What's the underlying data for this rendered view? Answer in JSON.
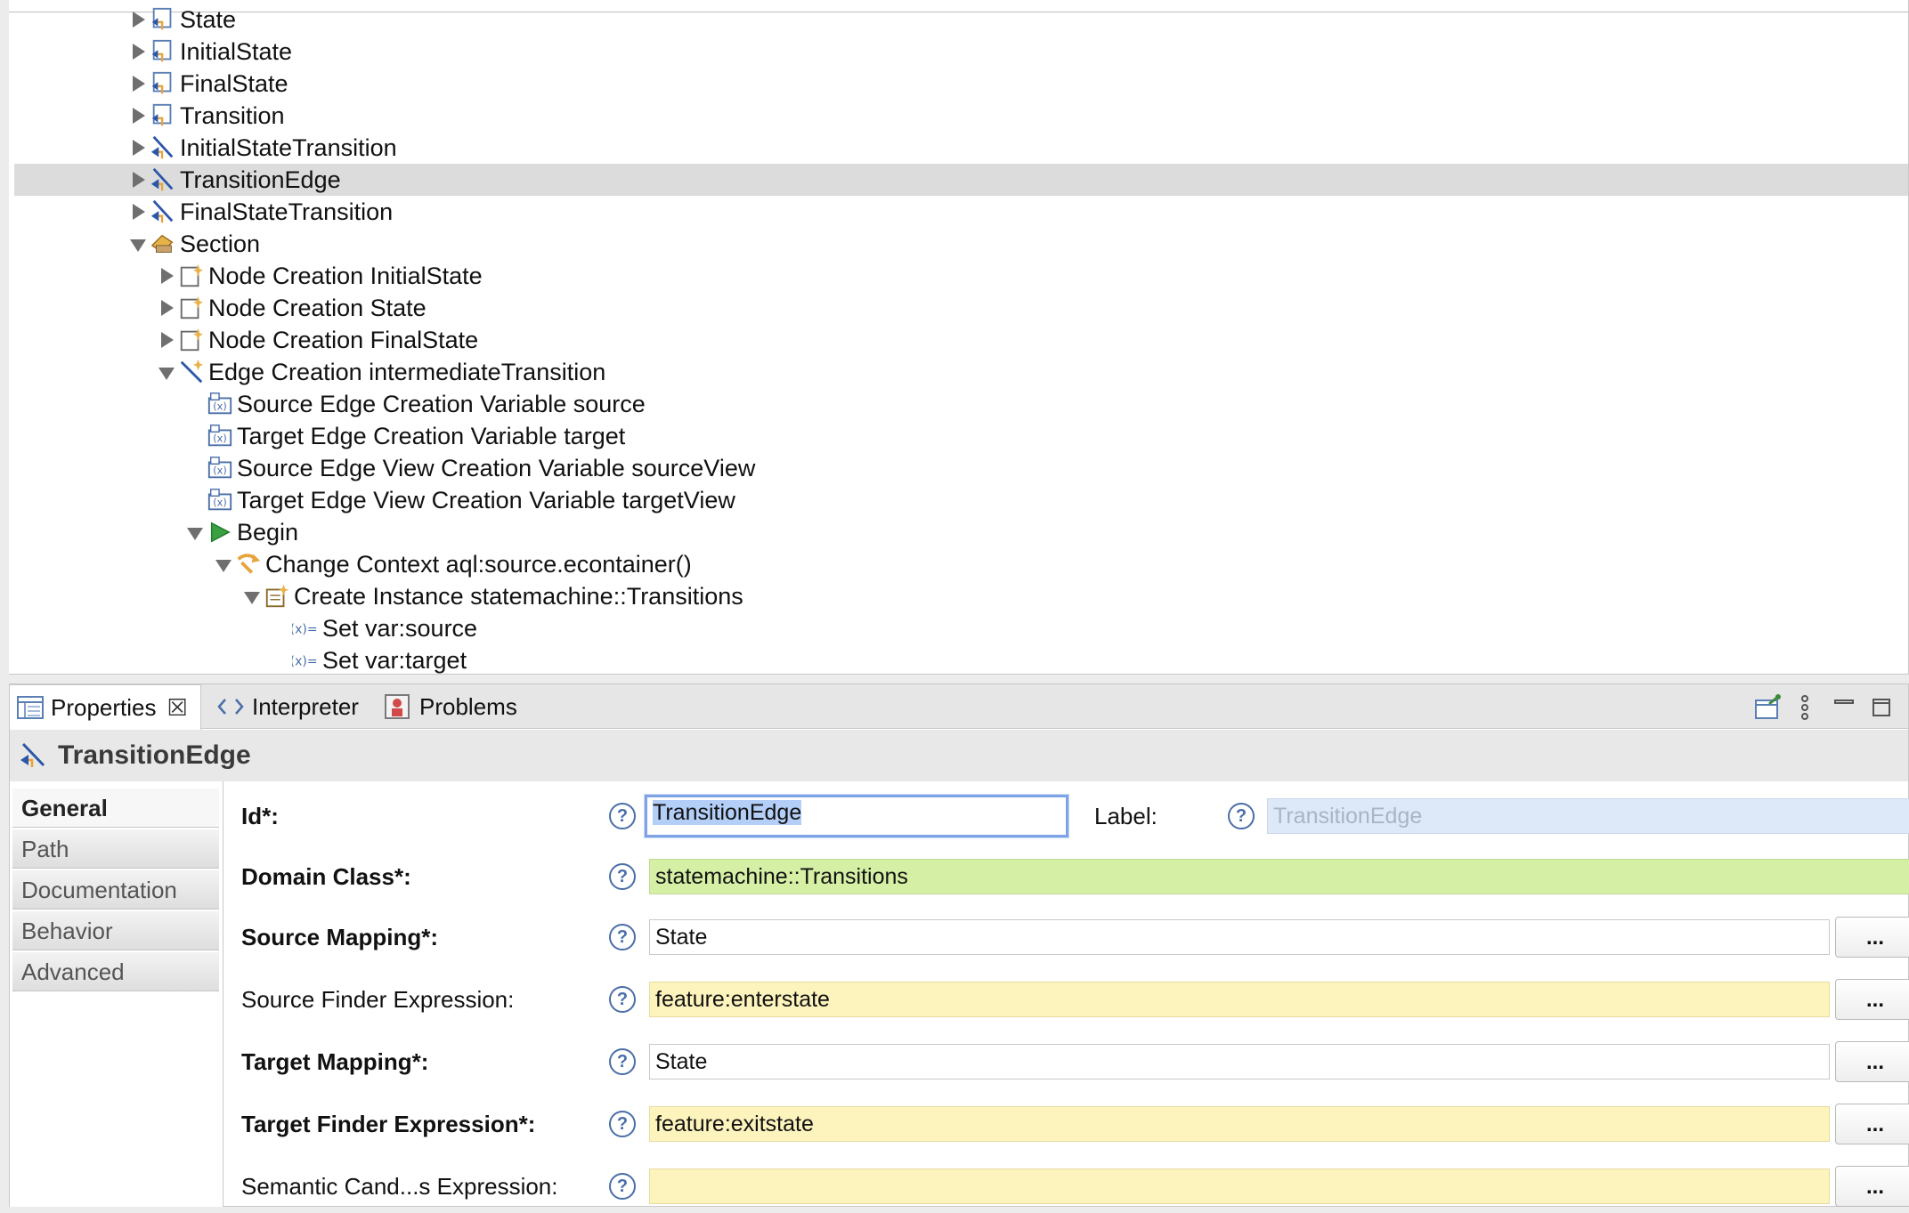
{
  "tree": [
    {
      "label": "State",
      "depth": 0,
      "state": "collapsed",
      "icon": "node-mapping-icon"
    },
    {
      "label": "InitialState",
      "depth": 0,
      "state": "collapsed",
      "icon": "node-mapping-icon"
    },
    {
      "label": "FinalState",
      "depth": 0,
      "state": "collapsed",
      "icon": "node-mapping-icon"
    },
    {
      "label": "Transition",
      "depth": 0,
      "state": "collapsed",
      "icon": "node-mapping-icon"
    },
    {
      "label": "InitialStateTransition",
      "depth": 0,
      "state": "collapsed",
      "icon": "edge-mapping-icon"
    },
    {
      "label": "TransitionEdge",
      "depth": 0,
      "state": "collapsed",
      "icon": "edge-mapping-icon",
      "selected": true
    },
    {
      "label": "FinalStateTransition",
      "depth": 0,
      "state": "collapsed",
      "icon": "edge-mapping-icon"
    },
    {
      "label": "Section",
      "depth": 0,
      "state": "expanded",
      "icon": "tool-section-icon"
    },
    {
      "label": "Node Creation InitialState",
      "depth": 1,
      "state": "collapsed",
      "icon": "node-creation-icon"
    },
    {
      "label": "Node Creation State",
      "depth": 1,
      "state": "collapsed",
      "icon": "node-creation-icon"
    },
    {
      "label": "Node Creation FinalState",
      "depth": 1,
      "state": "collapsed",
      "icon": "node-creation-icon"
    },
    {
      "label": "Edge Creation intermediateTransition",
      "depth": 1,
      "state": "expanded",
      "icon": "edge-creation-icon"
    },
    {
      "label": "Source Edge Creation Variable source",
      "depth": 2,
      "state": "none",
      "icon": "variable-icon"
    },
    {
      "label": "Target Edge Creation Variable target",
      "depth": 2,
      "state": "none",
      "icon": "variable-icon"
    },
    {
      "label": "Source Edge View Creation Variable sourceView",
      "depth": 2,
      "state": "none",
      "icon": "variable-icon"
    },
    {
      "label": "Target Edge View Creation Variable targetView",
      "depth": 2,
      "state": "none",
      "icon": "variable-icon"
    },
    {
      "label": "Begin",
      "depth": 2,
      "state": "expanded",
      "icon": "begin-icon"
    },
    {
      "label": "Change Context aql:source.econtainer()",
      "depth": 3,
      "state": "expanded",
      "icon": "change-context-icon"
    },
    {
      "label": "Create Instance statemachine::Transitions",
      "depth": 4,
      "state": "expanded",
      "icon": "create-instance-icon"
    },
    {
      "label": "Set var:source",
      "depth": 5,
      "state": "none",
      "icon": "set-value-icon"
    },
    {
      "label": "Set var:target",
      "depth": 5,
      "state": "none",
      "icon": "set-value-icon"
    }
  ],
  "tabs": {
    "properties": "Properties",
    "interpreter": "Interpreter",
    "problems": "Problems",
    "close_glyph": "☒"
  },
  "properties": {
    "title": "TransitionEdge",
    "side_tabs": [
      "General",
      "Path",
      "Documentation",
      "Behavior",
      "Advanced"
    ],
    "help_glyph": "?",
    "dots": "...",
    "fields": {
      "id_label": "Id*:",
      "id_value": "TransitionEdge",
      "label_label": "Label:",
      "label_value": "TransitionEdge",
      "domain_class_label": "Domain Class*:",
      "domain_class_value": "statemachine::Transitions",
      "source_mapping_label": "Source Mapping*:",
      "source_mapping_value": "State",
      "source_finder_label": "Source Finder Expression:",
      "source_finder_value": "feature:enterstate",
      "target_mapping_label": "Target Mapping*:",
      "target_mapping_value": "State",
      "target_finder_label": "Target Finder Expression*:",
      "target_finder_value": "feature:exitstate",
      "semantic_cand_label": "Semantic Cand...s Expression:",
      "semantic_cand_value": ""
    }
  },
  "colors": {
    "required_green": "#d5efa5",
    "expression_yellow": "#fdf3bd",
    "focus_blue": "#7fa4e6",
    "selection_gray": "#dcdcdc"
  }
}
